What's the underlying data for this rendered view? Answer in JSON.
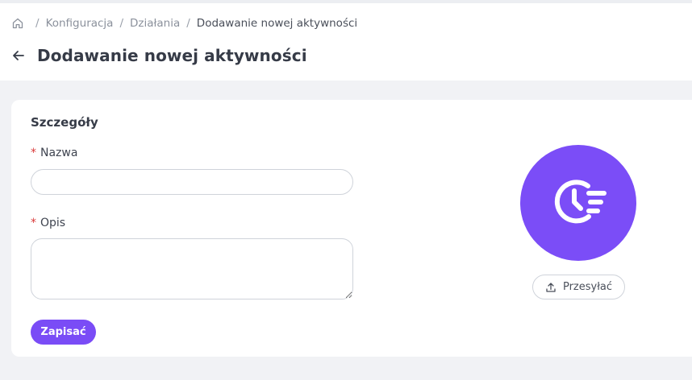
{
  "breadcrumb": {
    "home_icon": "home-icon",
    "items": [
      "Konfiguracja",
      "Działania"
    ],
    "current": "Dodawanie nowej aktywności",
    "separator": "/"
  },
  "page": {
    "title": "Dodawanie nowej aktywności",
    "back_icon": "arrow-left-icon"
  },
  "details": {
    "section_title": "Szczegóły",
    "required_marker": "*",
    "name_label": "Nazwa",
    "name_value": "",
    "description_label": "Opis",
    "description_value": "",
    "save_label": "Zapisać"
  },
  "avatar": {
    "icon": "clock-list-icon",
    "upload_label": "Przesyłać",
    "upload_icon": "upload-icon"
  },
  "colors": {
    "accent": "#7a4cf6",
    "required": "#d93a3a",
    "background": "#f1f2f5"
  }
}
